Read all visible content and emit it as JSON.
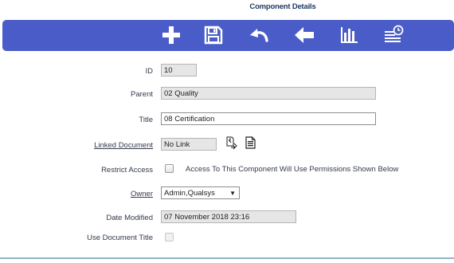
{
  "header": {
    "title": "Component Details"
  },
  "toolbar": {
    "buttons": [
      {
        "icon": "plus-icon",
        "action": "add"
      },
      {
        "icon": "floppy-disk-icon",
        "action": "save"
      },
      {
        "icon": "undo-arrow-icon",
        "action": "undo"
      },
      {
        "icon": "left-arrow-icon",
        "action": "back"
      },
      {
        "icon": "bar-chart-icon",
        "action": "chart"
      },
      {
        "icon": "history-list-icon",
        "action": "history"
      }
    ]
  },
  "form": {
    "id": {
      "label": "ID",
      "value": "10"
    },
    "parent": {
      "label": "Parent",
      "value": "02 Quality"
    },
    "title": {
      "label": "Title",
      "value": "08 Certification"
    },
    "linked_document": {
      "label": "Linked Document",
      "value": "No Link"
    },
    "restrict_access": {
      "label": "Restrict Access",
      "note": "Access To This Component Will Use Permissions Shown Below"
    },
    "owner": {
      "label": "Owner",
      "value": "Admin,Qualsys",
      "arrow": "▼"
    },
    "date_modified": {
      "label": "Date Modified",
      "value": "07 November 2018 23:16"
    },
    "use_document_title": {
      "label": "Use Document Title"
    }
  },
  "colors": {
    "toolbar": "#4a5cc7",
    "title": "#1f3864",
    "bottom_line": "#8fb4c9"
  }
}
